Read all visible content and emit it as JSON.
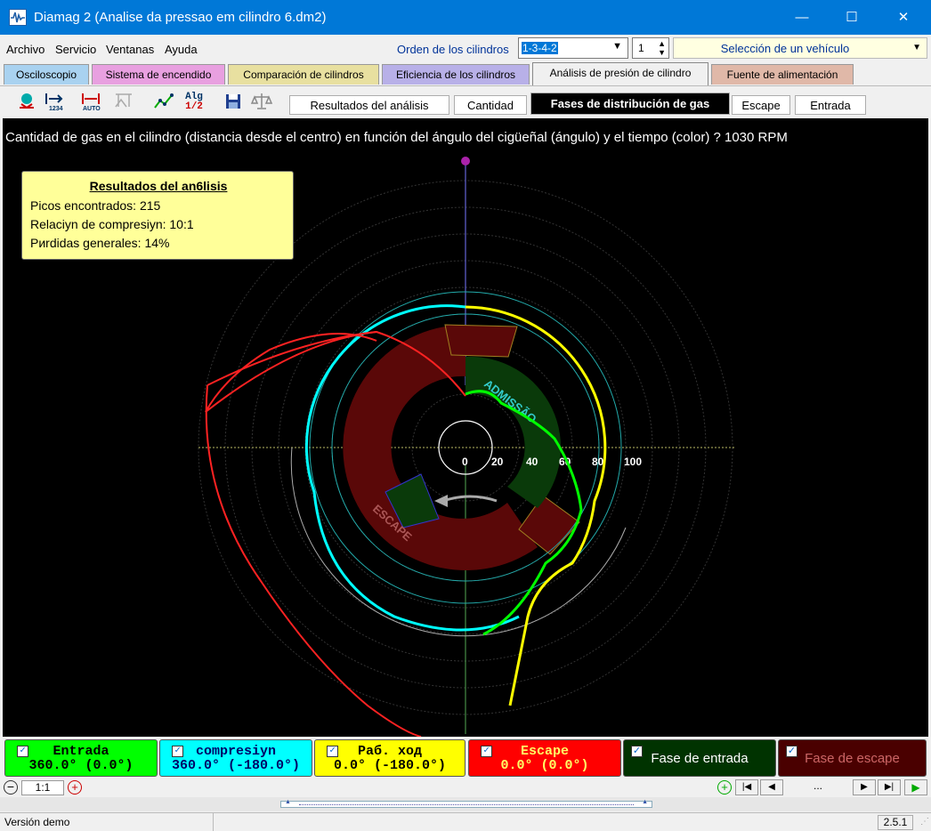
{
  "window": {
    "title": "Diamag 2 (Analise da pressao em cilindro 6.dm2)",
    "minimize": "—",
    "maximize": "☐",
    "close": "✕"
  },
  "menu": {
    "items": [
      "Archivo",
      "Servicio",
      "Ventanas",
      "Ayuda"
    ]
  },
  "cylinders": {
    "label": "Orden de los cilindros",
    "value": "1-3-4-2",
    "number": "1",
    "vehicle": "Selección de un vehículo"
  },
  "tabs": [
    "Osciloscopio",
    "Sistema de encendido",
    "Comparación de cilindros",
    "Eficiencia de los cilindros",
    "Análisis de presión de cilindro",
    "Fuente de alimentación"
  ],
  "toolbar": {
    "icons": [
      "oscilloscope-icon",
      "numbering-icon",
      "auto-scale-icon",
      "disabled-scale-icon",
      "graph-icon",
      "algorithm-icon",
      "save-icon",
      "balance-icon"
    ],
    "alg_label": "Alg",
    "alg_frac": "1/2",
    "num_label": "1234",
    "auto_label": "AUTO"
  },
  "subtabs": [
    "Resultados del análisis",
    "Cantidad",
    "Fases de distribución de gas",
    "Escape",
    "Entrada"
  ],
  "plot": {
    "title": "Cantidad de gas en el cilindro (distancia desde el centro) en función del ángulo del cigüeñal (ángulo) y el tiempo (color) ? 1030 RPM",
    "radial_ticks": [
      "0",
      "20",
      "40",
      "60",
      "80",
      "100"
    ],
    "admission_label": "ADMISSÃO",
    "escape_label": "ESCAPE"
  },
  "results": {
    "title": "Resultados del an6lisis",
    "lines": [
      "Picos encontrados: 215",
      "Relaciyn de compresiyn: 10:1",
      "Pиrdidas generales: 14%"
    ]
  },
  "legend": [
    {
      "name": "Entrada",
      "value": "360.0° (0.0°)",
      "bg": "#00ff00",
      "fg": "#000000"
    },
    {
      "name": "compresiyn",
      "value": "360.0° (-180.0°)",
      "bg": "#00ffff",
      "fg": "#000066"
    },
    {
      "name": "Раб. ход",
      "value": "0.0° (-180.0°)",
      "bg": "#ffff00",
      "fg": "#000000"
    },
    {
      "name": "Escape",
      "value": "0.0° (0.0°)",
      "bg": "#ff0000",
      "fg": "#ffff66"
    },
    {
      "name": "Fase de entrada",
      "bg": "#003300",
      "fg": "#ffffff"
    },
    {
      "name": "Fase de escape",
      "bg": "#4a0000",
      "fg": "#cc6666"
    }
  ],
  "nav": {
    "zoom": "1:1",
    "dots": "..."
  },
  "status": {
    "left": "Versión demo",
    "version": "2.5.1"
  },
  "colors": {
    "titlebar": "#0078d7",
    "intake": "#00ff00",
    "compression": "#00ffff",
    "power": "#ffff00",
    "exhaust": "#ff0000"
  }
}
